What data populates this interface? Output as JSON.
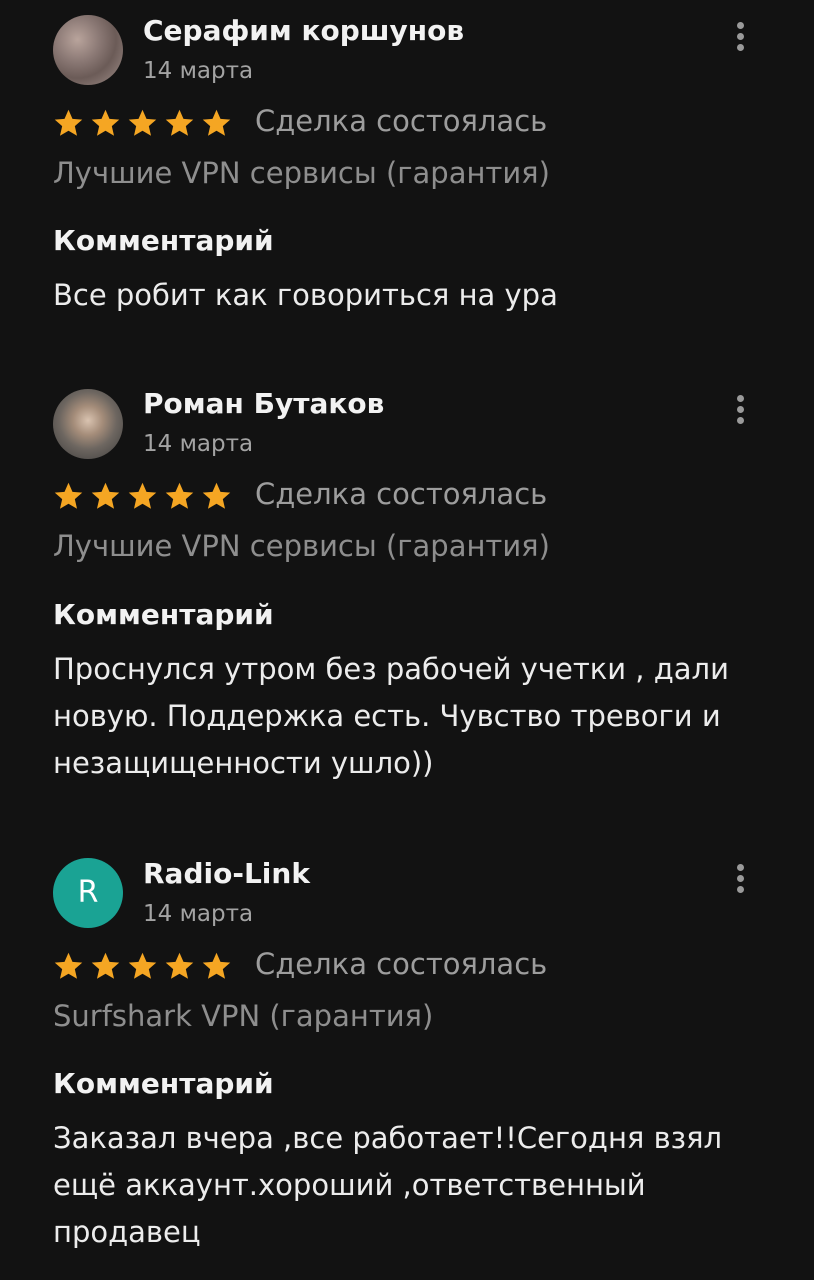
{
  "colors": {
    "background": "#121212",
    "star": "#f5a623",
    "avatar_letter_bg": "#1aa394"
  },
  "reviews": [
    {
      "author": "Серафим коршунов",
      "date": "14 марта",
      "avatar": "pattern-image",
      "rating": 5,
      "status": "Сделка состоялась",
      "product": "Лучшие VPN сервисы (гарантия)",
      "comment_label": "Комментарий",
      "comment": "Все робит как говориться на ура"
    },
    {
      "author": "Роман Бутаков",
      "date": "14 марта",
      "avatar": "photo",
      "rating": 5,
      "status": "Сделка состоялась",
      "product": "Лучшие VPN сервисы (гарантия)",
      "comment_label": "Комментарий",
      "comment": "Проснулся утром без рабочей учетки , дали новую. Поддержка есть. Чувство тревоги и незащищенности ушло))"
    },
    {
      "author": "Radio-Link",
      "date": "14 марта",
      "avatar": "letter",
      "avatar_letter": "R",
      "rating": 5,
      "status": "Сделка состоялась",
      "product": "Surfshark VPN (гарантия)",
      "comment_label": "Комментарий",
      "comment": "Заказал вчера ,все работает!!Сегодня взял ещё аккаунт.хороший ,ответственный продавец"
    }
  ],
  "icons": {
    "star": "star-icon",
    "more": "more-vertical-icon"
  }
}
